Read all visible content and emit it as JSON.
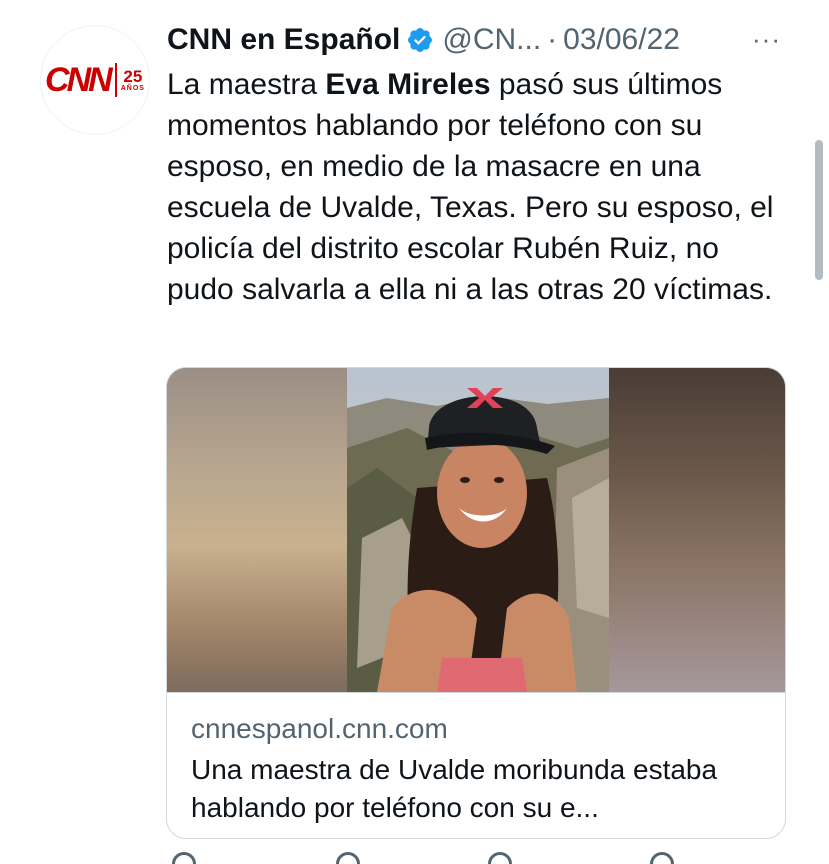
{
  "tweet": {
    "author_name": "CNN en Español",
    "handle": "@CN...",
    "separator": "·",
    "date": "03/06/22",
    "more": "···",
    "text_before": "La maestra ",
    "text_bold": "Eva Mireles",
    "text_after": " pasó sus últimos momentos hablando por teléfono con su esposo, en medio de la masacre en una escuela de Uvalde, Texas. Pero su esposo, el policía del distrito escolar Rubén Ruiz, no pudo salvarla a ella ni a las otras 20 víctimas."
  },
  "avatar": {
    "logo_text": "CNN",
    "years_number": "25",
    "years_word": "AÑOS"
  },
  "card": {
    "domain": "cnnespanol.cnn.com",
    "title": "Una maestra de Uvalde moribunda estaba hablando por teléfono con su e..."
  },
  "colors": {
    "brand_red": "#cc0000",
    "verified_blue": "#1d9bf0",
    "secondary_text": "#536471"
  }
}
